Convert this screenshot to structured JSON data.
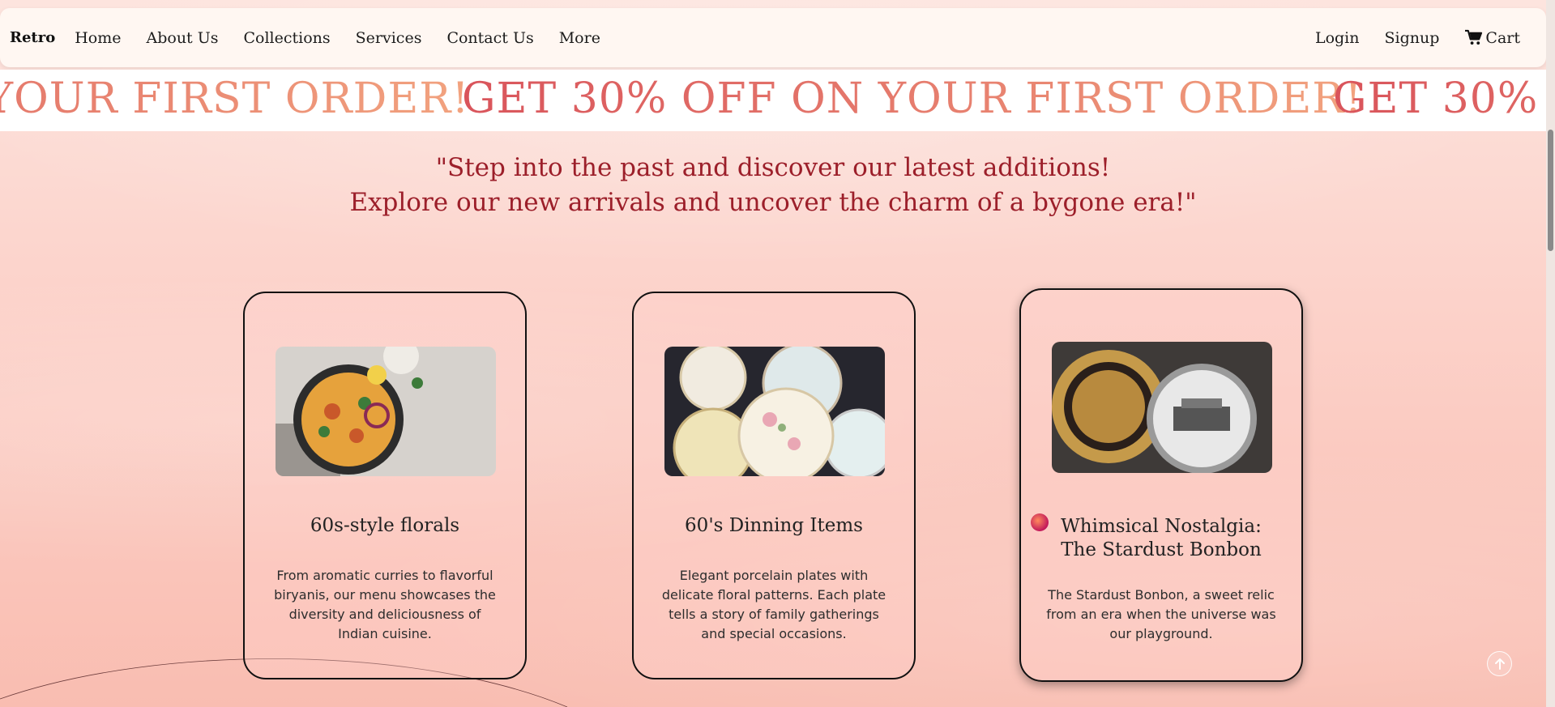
{
  "nav": {
    "brand": "Retro",
    "links": [
      "Home",
      "About Us",
      "Collections",
      "Services",
      "Contact Us",
      "More"
    ],
    "login": "Login",
    "signup": "Signup",
    "cart": "Cart"
  },
  "marquee": {
    "text": "GET 30% OFF ON YOUR FIRST ORDER!"
  },
  "headline": {
    "line1": "\"Step into the past and discover our latest additions!",
    "line2": "Explore our new arrivals and uncover the charm of a bygone era!\""
  },
  "cards": [
    {
      "title": "60s-style florals",
      "description": "From aromatic curries to flavorful biryanis, our menu showcases the diversity and deliciousness of Indian cuisine.",
      "image": "biryani-pan-image"
    },
    {
      "title": "60's Dinning Items",
      "description": "Elegant porcelain plates with delicate floral patterns. Each plate tells a story of family gatherings and special occasions.",
      "image": "vintage-plates-image"
    },
    {
      "title_line1": "Whimsical Nostalgia:",
      "title_line2": "The Stardust Bonbon",
      "description": "The Stardust Bonbon, a sweet relic from an era when the universe was our playground.",
      "image": "vintage-tins-image"
    }
  ],
  "icons": {
    "cart": "cart-icon",
    "back_to_top": "arrow-up-icon"
  },
  "colors": {
    "headline": "#9c1f2a",
    "marquee_gradient_start": "#d9545b",
    "marquee_gradient_end": "#f2a37f",
    "page_bg": "#fcd3cb"
  }
}
